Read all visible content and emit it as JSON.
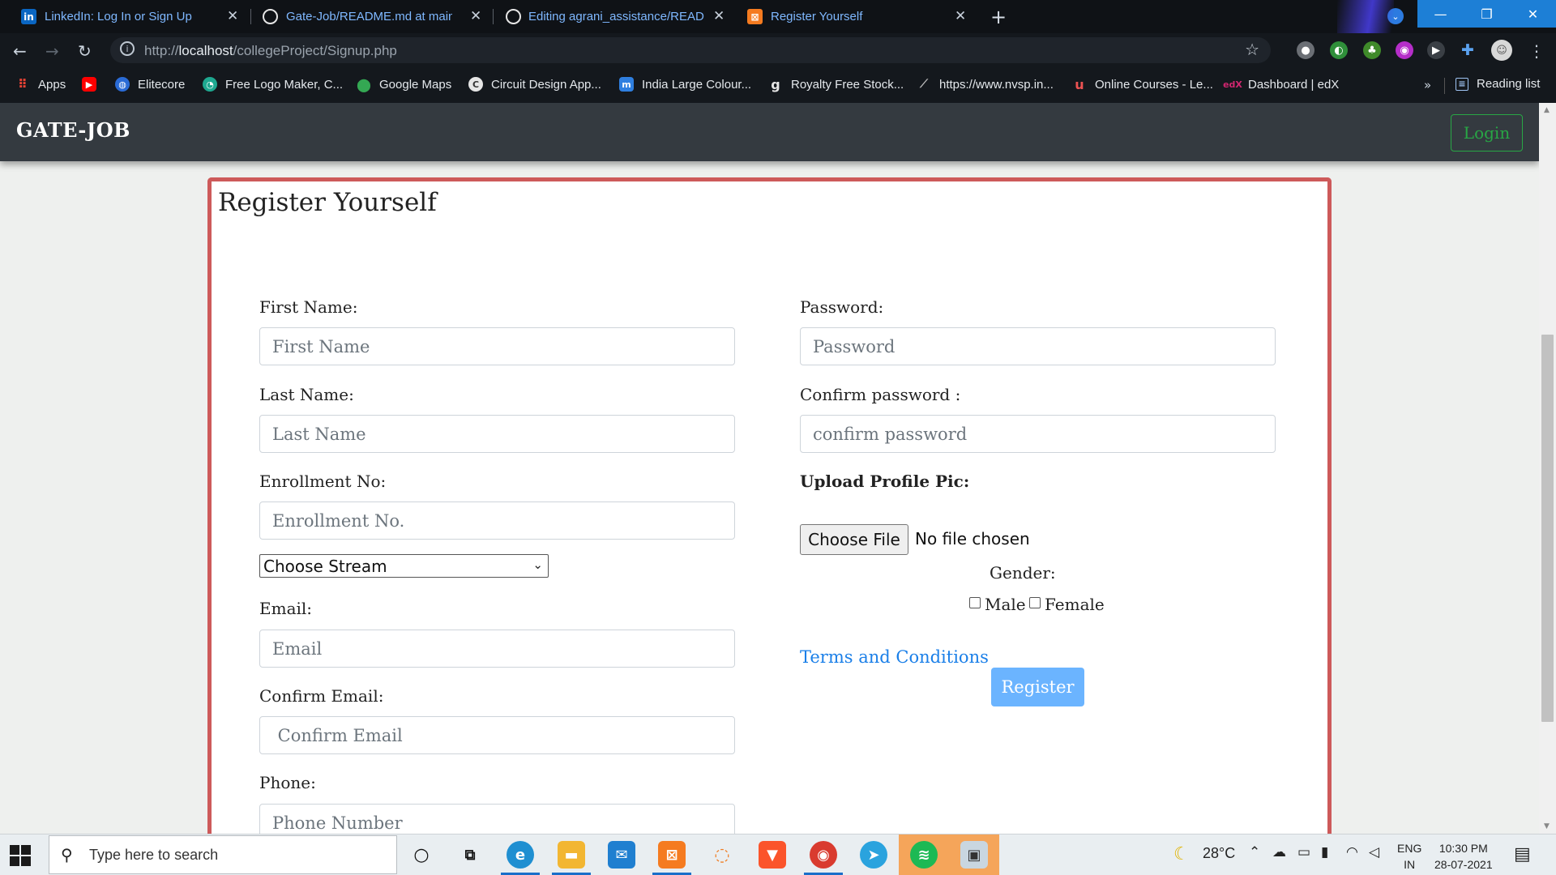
{
  "browser": {
    "tabs": [
      {
        "title": "LinkedIn: Log In or Sign Up",
        "favicon": "linkedin-icon"
      },
      {
        "title": "Gate-Job/README.md at main · ",
        "favicon": "github-icon"
      },
      {
        "title": "Editing agrani_assistance/READM",
        "favicon": "github-icon"
      },
      {
        "title": "Register Yourself",
        "favicon": "xampp-icon"
      }
    ],
    "url_host": "localhost",
    "url_prefix": "http://",
    "url_path": "/collegeProject/Signup.php",
    "bookmarks": [
      {
        "label": "Apps",
        "icon": "apps-grid-icon"
      },
      {
        "label": "",
        "icon": "youtube-icon"
      },
      {
        "label": "Elitecore",
        "icon": "globe-icon"
      },
      {
        "label": "Free Logo Maker, C...",
        "icon": "logo-maker-icon"
      },
      {
        "label": "Google Maps",
        "icon": "maps-pin-icon"
      },
      {
        "label": "Circuit Design App...",
        "icon": "circuit-icon"
      },
      {
        "label": "India Large Colour...",
        "icon": "m-icon"
      },
      {
        "label": "Royalty Free Stock...",
        "icon": "stock-icon"
      },
      {
        "label": "https://www.nvsp.in...",
        "icon": "nvsp-icon"
      },
      {
        "label": "Online Courses - Le...",
        "icon": "udemy-icon"
      },
      {
        "label": "Dashboard | edX",
        "icon": "edx-icon"
      }
    ],
    "bookmarks_more": "»",
    "reading_list": "Reading list"
  },
  "navbar": {
    "brand": "GATE-JOB",
    "login": "Login"
  },
  "form": {
    "title": "Register Yourself",
    "first_name_label": "First Name:",
    "first_name_placeholder": "First Name",
    "last_name_label": "Last Name:",
    "last_name_placeholder": "Last Name",
    "enrollment_label": "Enrollment No:",
    "enrollment_placeholder": "Enrollment No.",
    "stream_selected": "Choose Stream",
    "email_label": "Email:",
    "email_placeholder": "Email",
    "confirm_email_label": "Confirm Email:",
    "confirm_email_placeholder": " Confirm Email",
    "phone_label": "Phone:",
    "phone_placeholder": "Phone Number",
    "password_label": "Password:",
    "password_placeholder": "Password",
    "confirm_password_label": "Confirm password :",
    "confirm_password_placeholder": "confirm password",
    "upload_label": "Upload Profile Pic:",
    "choose_file": "Choose File",
    "file_status": "No file chosen",
    "gender_label": "Gender:",
    "male": "Male",
    "female": "Female",
    "terms": "Terms and Conditions",
    "register": "Register"
  },
  "taskbar": {
    "search_placeholder": "Type here to search",
    "temperature": "28°C",
    "lang_top": "ENG",
    "lang_bottom": "IN",
    "time": "10:30 PM",
    "date": "28-07-2021"
  },
  "colors": {
    "card_border": "#cd5a5a",
    "login_green": "#28a745",
    "register_blue": "#6bb4ff",
    "link_blue": "#1a7fe8",
    "navbar": "#343a40"
  }
}
